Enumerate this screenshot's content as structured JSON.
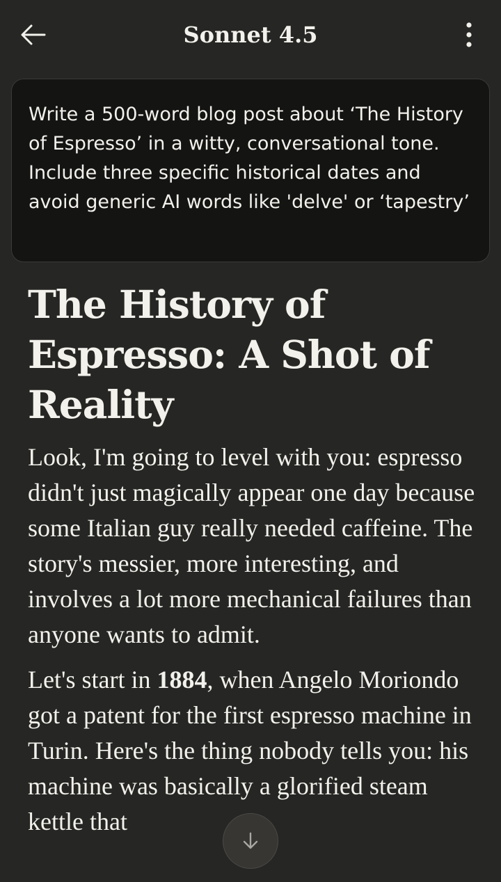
{
  "header": {
    "title": "Sonnet 4.5",
    "back_icon": "arrow-left-icon",
    "menu_icon": "vertical-dots-icon"
  },
  "prompt": {
    "text": "Write a 500-word blog post about ‘The History of Espresso’ in a witty, conversational tone. Include three specific historical dates and avoid generic AI words like 'delve' or ‘tapestry’"
  },
  "response": {
    "heading": "The History of Espresso: A Shot of Reality",
    "paragraph_1": "Look, I'm going to level with you: espresso didn't just magically appear one day because some Italian guy really needed caffeine. The story's messier, more interesting, and involves a lot more mechanical failures than anyone wants to admit.",
    "paragraph_2_before": "Let's start in ",
    "paragraph_2_bold": "1884",
    "paragraph_2_after": ", when Angelo Moriondo got a patent for the first espresso machine in Turin. Here's the thing nobody tells you: his machine was basically a glorified steam kettle that"
  },
  "scroll_button": {
    "icon": "arrow-down-icon"
  },
  "colors": {
    "background": "#262624",
    "card": "#141413",
    "text": "#f3f1ec"
  }
}
